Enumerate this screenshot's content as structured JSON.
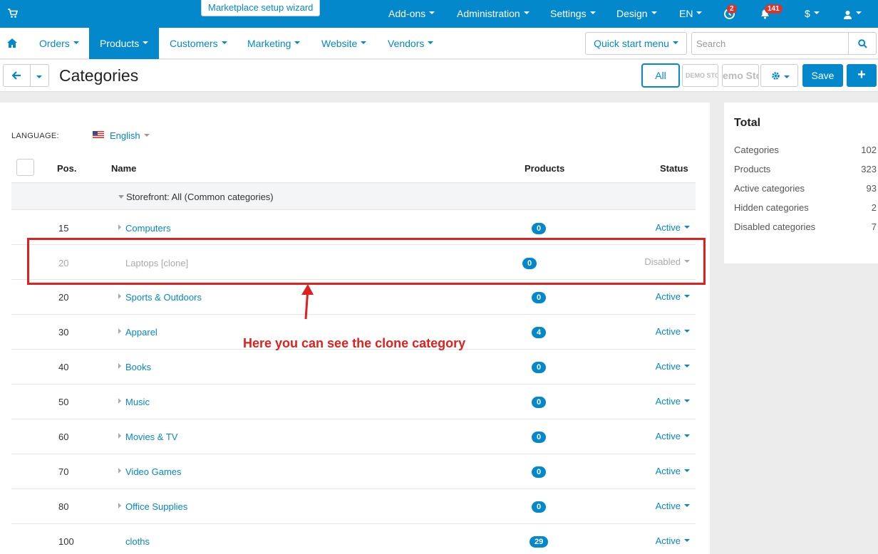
{
  "topbar": {
    "wizard": "Marketplace setup wizard",
    "menus": [
      "Add-ons",
      "Administration",
      "Settings",
      "Design",
      "EN"
    ],
    "badge_updates": "2",
    "badge_notifications": "141",
    "currency": "$"
  },
  "nav": {
    "items": [
      "Orders",
      "Products",
      "Customers",
      "Marketing",
      "Website",
      "Vendors"
    ],
    "active": "Products",
    "quick_start": "Quick start menu",
    "search_placeholder": "Search"
  },
  "titlebar": {
    "title": "Categories",
    "all_label": "All",
    "store1": "DEMO STO",
    "store2": "emo Sto",
    "save": "Save",
    "add": "+"
  },
  "language": {
    "label": "LANGUAGE:",
    "value": "English"
  },
  "table": {
    "headers": {
      "pos": "Pos.",
      "name": "Name",
      "products": "Products",
      "status": "Status"
    },
    "group": "Storefront: All (Common categories)",
    "rows": [
      {
        "pos": "15",
        "name": "Computers",
        "products": "0",
        "status": "Active",
        "disabled": false
      },
      {
        "pos": "20",
        "name": "Laptops [clone]",
        "products": "0",
        "status": "Disabled",
        "disabled": true
      },
      {
        "pos": "20",
        "name": "Sports & Outdoors",
        "products": "0",
        "status": "Active",
        "disabled": false
      },
      {
        "pos": "30",
        "name": "Apparel",
        "products": "4",
        "status": "Active",
        "disabled": false
      },
      {
        "pos": "40",
        "name": "Books",
        "products": "0",
        "status": "Active",
        "disabled": false
      },
      {
        "pos": "50",
        "name": "Music",
        "products": "0",
        "status": "Active",
        "disabled": false
      },
      {
        "pos": "60",
        "name": "Movies & TV",
        "products": "0",
        "status": "Active",
        "disabled": false
      },
      {
        "pos": "70",
        "name": "Video Games",
        "products": "0",
        "status": "Active",
        "disabled": false
      },
      {
        "pos": "80",
        "name": "Office Supplies",
        "products": "0",
        "status": "Active",
        "disabled": false
      },
      {
        "pos": "100",
        "name": "cloths",
        "products": "29",
        "status": "Active",
        "disabled": false
      }
    ]
  },
  "totals": {
    "title": "Total",
    "items": [
      {
        "label": "Categories",
        "value": "102"
      },
      {
        "label": "Products",
        "value": "323"
      },
      {
        "label": "Active categories",
        "value": "93"
      },
      {
        "label": "Hidden categories",
        "value": "2"
      },
      {
        "label": "Disabled categories",
        "value": "7"
      }
    ]
  },
  "annotation": {
    "text": "Here you can see the clone category",
    "color": "#e0201d"
  },
  "colors": {
    "accent": "#0388cc",
    "danger": "#d9352c"
  }
}
